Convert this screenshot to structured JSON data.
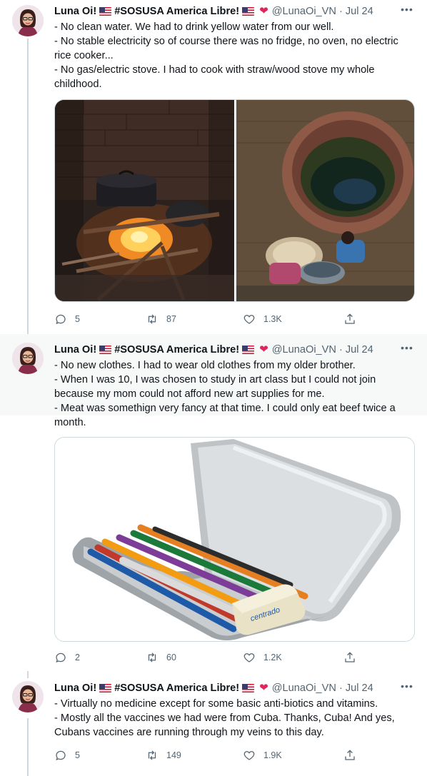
{
  "tweets": [
    {
      "author": {
        "display_name": "Luna Oi!",
        "tag": "#SOSUSA America Libre!",
        "handle": "@LunaOi_VN",
        "separator": "·",
        "date": "Jul 24"
      },
      "lines": [
        "- No clean water. We had to drink yellow water from our well.",
        "- No stable electricity so of course there was no fridge, no oven, no electric rice cooker...",
        "- No gas/electric stove. I had to cook with straw/wood stove my whole childhood."
      ],
      "media": [
        "photo: pot cooking over a wood fire",
        "photo: people drawing water next to a brick well"
      ],
      "stats": {
        "replies": "5",
        "retweets": "87",
        "likes": "1.3K"
      }
    },
    {
      "author": {
        "display_name": "Luna Oi!",
        "tag": "#SOSUSA America Libre!",
        "handle": "@LunaOi_VN",
        "separator": "·",
        "date": "Jul 24"
      },
      "lines": [
        "- No new clothes. I had to wear old clothes from my older brother.",
        "- When I was 10, I was chosen to study in art class but I could not join because my mom could not afford new art supplies for me.",
        "- Meat was somethign very fancy at that time. I could only eat beef twice a month."
      ],
      "media": [
        "photo: metal pencil case with colored pencils and eraser"
      ],
      "eraser_brand": "centrado",
      "stats": {
        "replies": "2",
        "retweets": "60",
        "likes": "1.2K"
      }
    },
    {
      "author": {
        "display_name": "Luna Oi!",
        "tag": "#SOSUSA America Libre!",
        "handle": "@LunaOi_VN",
        "separator": "·",
        "date": "Jul 24"
      },
      "lines": [
        "- Virtually no medicine except for some basic anti-biotics and vitamins.",
        "- Mostly all the vaccines we had were from Cuba. Thanks, Cuba! And yes, Cubans vaccines are running through my veins to this day."
      ],
      "stats": {
        "replies": "5",
        "retweets": "149",
        "likes": "1.9K"
      }
    }
  ],
  "icons": {
    "reply": "reply-icon",
    "retweet": "retweet-icon",
    "like": "heart-icon",
    "share": "share-icon",
    "more": "more-icon",
    "verified_heart": "red-heart-emoji",
    "flag": "us-flag-emoji"
  },
  "colors": {
    "text": "#0f1419",
    "secondary": "#536471",
    "thread_line": "#cfd9de",
    "heart": "#e0245e",
    "highlight_bg": "#f7f9f9"
  }
}
